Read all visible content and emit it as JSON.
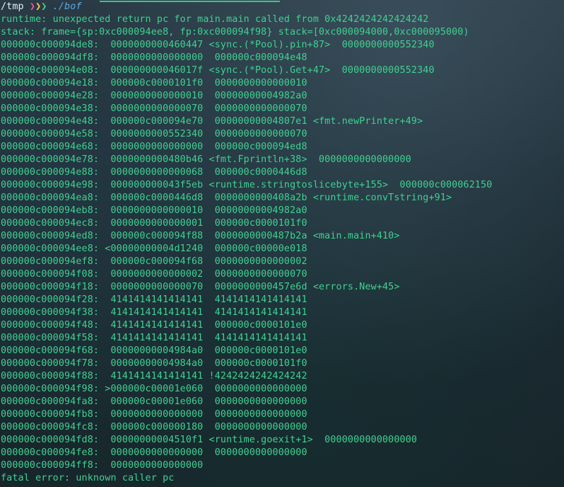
{
  "prompt": {
    "cwd": "/tmp",
    "arrows": [
      "❯",
      "❯",
      "❯"
    ],
    "command": "./bof"
  },
  "output": [
    "runtime: unexpected return pc for main.main called from 0x4242424242424242",
    "stack: frame={sp:0xc000094ee8, fp:0xc000094f98} stack=[0xc000094000,0xc000095000)",
    "000000c000094de8:  0000000000460447 <sync.(*Pool).pin+87>  0000000000552340",
    "000000c000094df8:  0000000000000000  000000c000094e48",
    "000000c000094e08:  000000000046017f <sync.(*Pool).Get+47>  0000000000552340",
    "000000c000094e18:  000000c0000101f0  0000000000000010",
    "000000c000094e28:  0000000000000010  00000000004982a0",
    "000000c000094e38:  0000000000000070  0000000000000070",
    "000000c000094e48:  000000c000094e70  00000000004807e1 <fmt.newPrinter+49>",
    "000000c000094e58:  0000000000552340  0000000000000070",
    "000000c000094e68:  0000000000000000  000000c000094ed8",
    "000000c000094e78:  0000000000480b46 <fmt.Fprintln+38>  0000000000000000",
    "000000c000094e88:  0000000000000068  000000c0000446d8",
    "000000c000094e98:  000000000043f5eb <runtime.stringtoslicebyte+155>  000000c000062150",
    "000000c000094ea8:  000000c0000446d8  0000000000408a2b <runtime.convTstring+91>",
    "000000c000094eb8:  0000000000000010  00000000004982a0",
    "000000c000094ec8:  0000000000000001  000000c0000101f0",
    "000000c000094ed8:  000000c000094f88  0000000000487b2a <main.main+410>",
    "000000c000094ee8: <00000000004d1240  000000c00000e018",
    "000000c000094ef8:  000000c000094f68  0000000000000002",
    "000000c000094f08:  0000000000000002  0000000000000070",
    "000000c000094f18:  0000000000000070  0000000000457e6d <errors.New+45>",
    "000000c000094f28:  4141414141414141  4141414141414141",
    "000000c000094f38:  4141414141414141  4141414141414141",
    "000000c000094f48:  4141414141414141  000000c0000101e0",
    "000000c000094f58:  4141414141414141  4141414141414141",
    "000000c000094f68:  00000000004984a0  000000c0000101e0",
    "000000c000094f78:  00000000004984a0  000000c0000101f0",
    "000000c000094f88:  4141414141414141 !4242424242424242",
    "000000c000094f98: >000000c00001e060  0000000000000000",
    "000000c000094fa8:  000000c00001e060  0000000000000000",
    "000000c000094fb8:  0000000000000000  0000000000000000",
    "000000c000094fc8:  000000c000000180  0000000000000000",
    "000000c000094fd8:  00000000004510f1 <runtime.goexit+1>  0000000000000000",
    "000000c000094fe8:  0000000000000000  0000000000000000",
    "000000c000094ff8:  0000000000000000",
    "fatal error: unknown caller pc"
  ],
  "colors": {
    "text": "#3fd191",
    "cwd": "#e6edf0",
    "arrow_1": "#ff4fa0",
    "arrow_2": "#ffd23f",
    "arrow_3": "#3fd191",
    "command": "#5aa8e8"
  }
}
